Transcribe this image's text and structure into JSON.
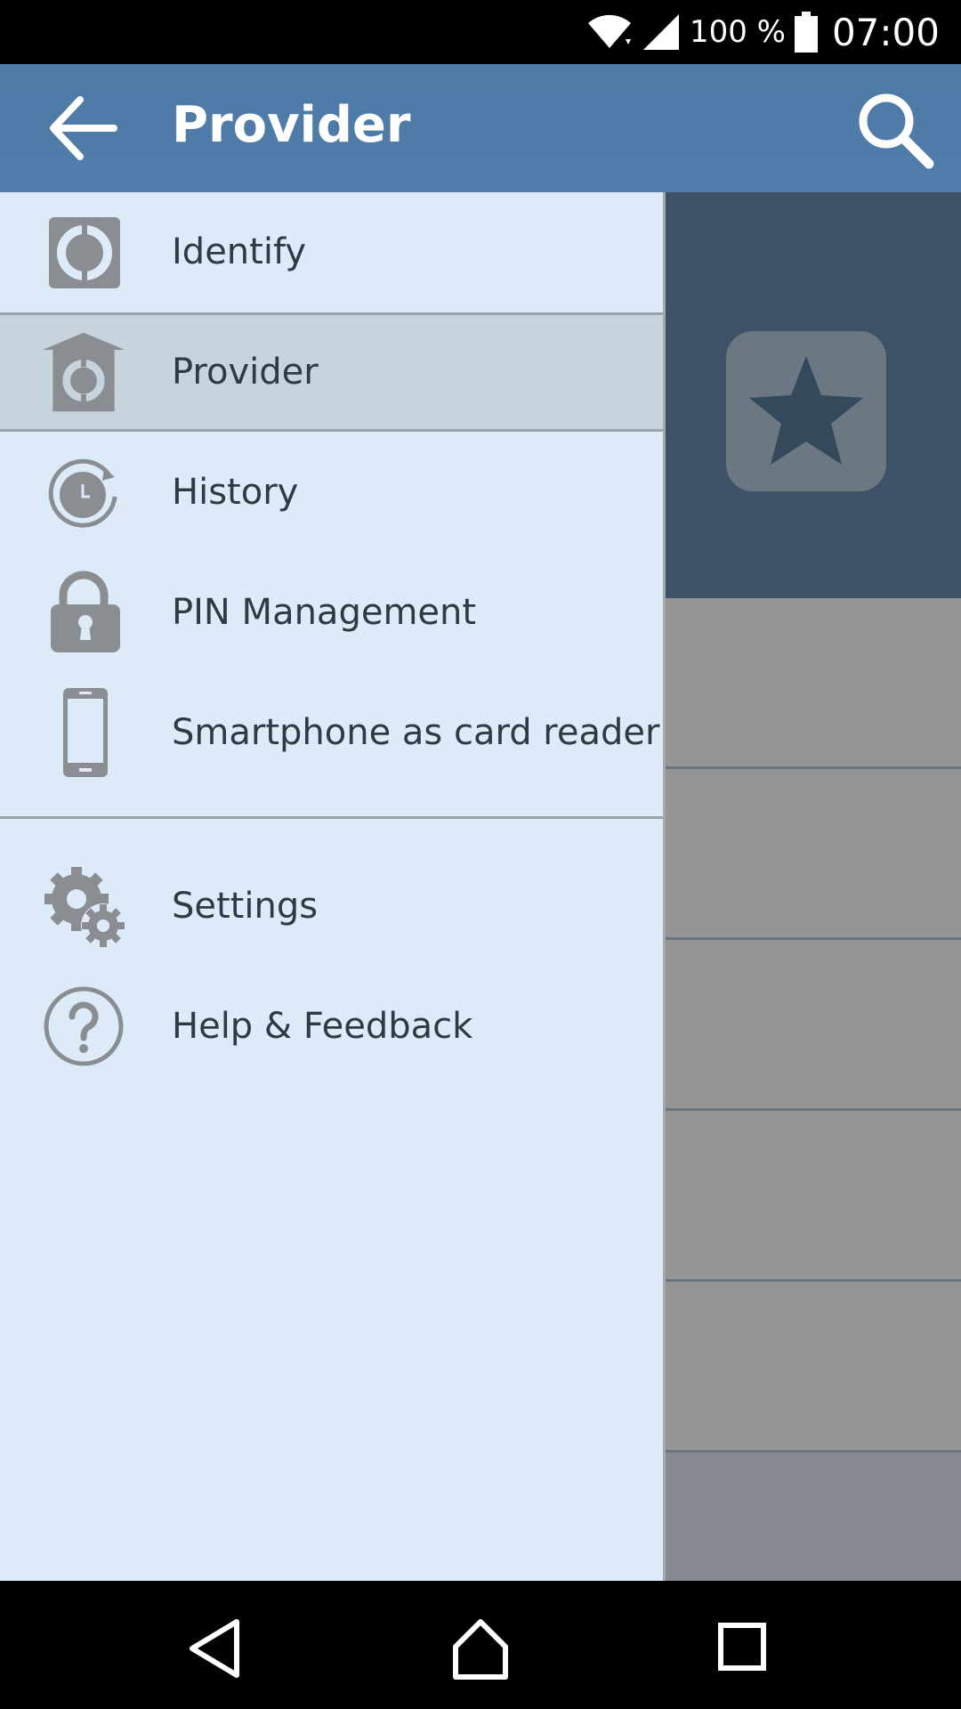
{
  "status_bar": {
    "battery": "100 %",
    "time": "07:00"
  },
  "app_bar": {
    "title": "Provider"
  },
  "drawer": {
    "items": [
      {
        "label": "Identify",
        "icon": "identify-icon"
      },
      {
        "label": "Provider",
        "icon": "provider-icon",
        "active": true
      },
      {
        "label": "History",
        "icon": "history-icon"
      },
      {
        "label": "PIN Management",
        "icon": "lock-icon"
      },
      {
        "label": "Smartphone as card reader",
        "icon": "smartphone-icon"
      }
    ],
    "secondary_items": [
      {
        "label": "Settings",
        "icon": "settings-icon"
      },
      {
        "label": "Help & Feedback",
        "icon": "help-icon"
      }
    ]
  },
  "colors": {
    "app_bar": "#4f7ca9",
    "drawer_bg": "#dcebf7",
    "active_item_bg": "#c6d4de",
    "icon_gray": "#8a8e93",
    "text": "#2e3a44"
  }
}
